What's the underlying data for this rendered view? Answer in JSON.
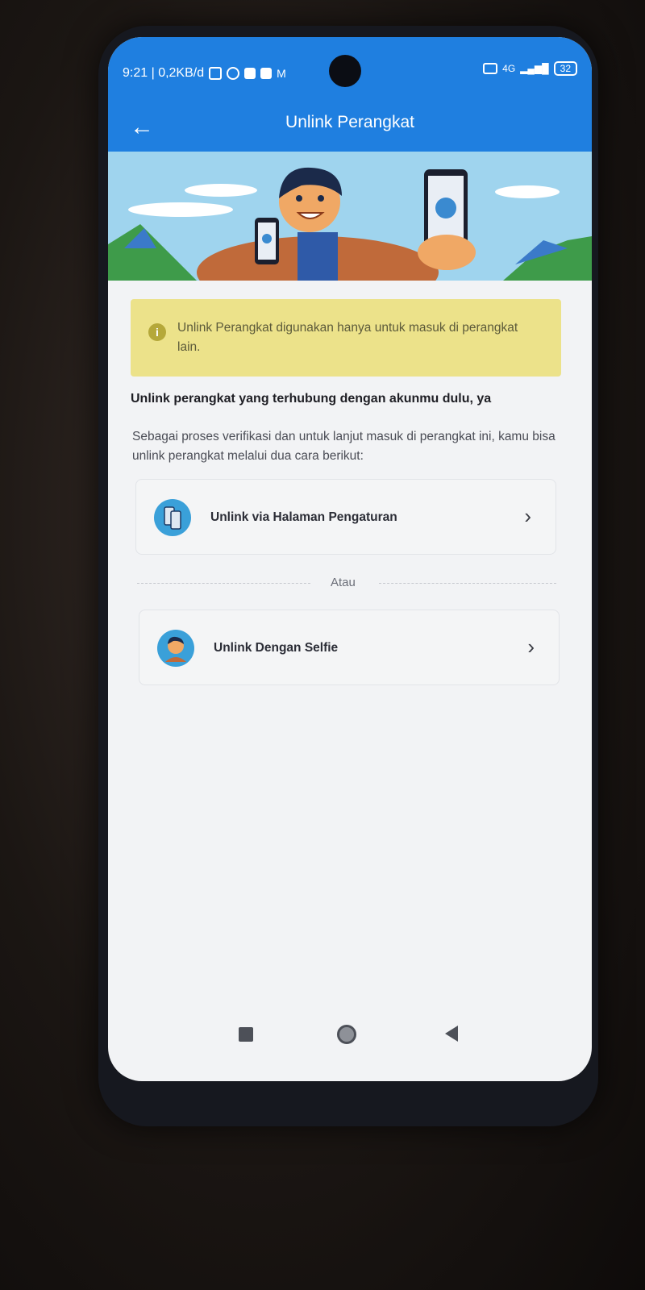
{
  "status_bar": {
    "time_info": "9:21 | 0,2KB/d",
    "battery": "32",
    "network": "4G"
  },
  "app_bar": {
    "title": "Unlink Perangkat",
    "back_icon": "arrow-left-icon"
  },
  "info_banner": {
    "text": "Unlink Perangkat digunakan hanya untuk masuk di perangkat lain."
  },
  "content": {
    "heading": "Unlink perangkat yang terhubung dengan akunmu dulu, ya",
    "description": "Sebagai proses verifikasi dan untuk lanjut masuk di perangkat ini, kamu bisa unlink perangkat melalui dua cara berikut:"
  },
  "options": [
    {
      "label": "Unlink via Halaman Pengaturan",
      "icon": "phone-settings-icon"
    },
    {
      "label": "Unlink Dengan Selfie",
      "icon": "selfie-avatar-icon"
    }
  ],
  "divider_text": "Atau",
  "colors": {
    "app_bar": "#1f7fe0",
    "info_bg": "#ece28a",
    "icon_accent": "#3aa0d9"
  }
}
